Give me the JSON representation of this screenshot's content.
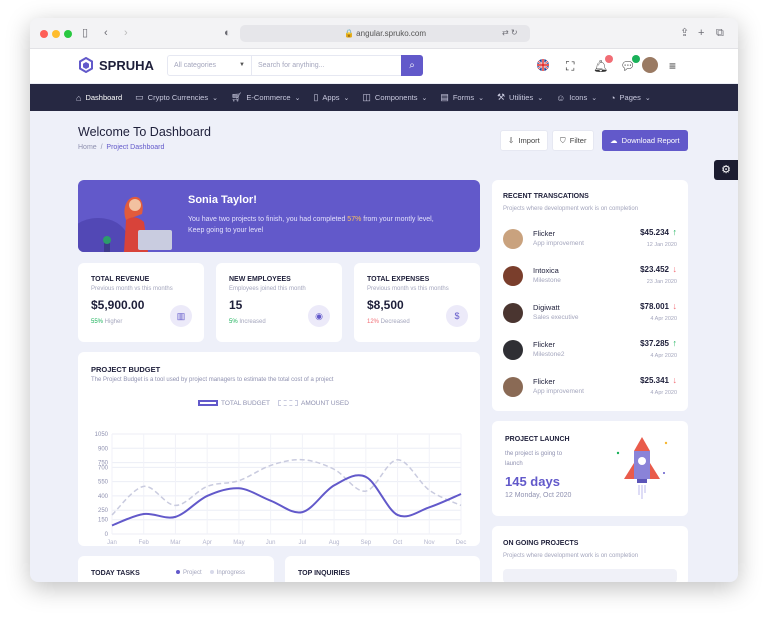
{
  "browser": {
    "url": "angular.spruko.com"
  },
  "brand": {
    "name": "SPRUHA",
    "accent": "#6259ca",
    "nav_bg": "#262842"
  },
  "header": {
    "category_select": "All categories",
    "search_placeholder": "Search for anything..."
  },
  "nav": [
    {
      "label": "Dashboard",
      "icon": "home-icon"
    },
    {
      "label": "Crypto Currencies",
      "icon": "monitor-icon"
    },
    {
      "label": "E-Commerce",
      "icon": "cart-icon"
    },
    {
      "label": "Apps",
      "icon": "apps-icon"
    },
    {
      "label": "Components",
      "icon": "box-icon"
    },
    {
      "label": "Forms",
      "icon": "form-icon"
    },
    {
      "label": "Utilities",
      "icon": "tool-icon"
    },
    {
      "label": "Icons",
      "icon": "smile-icon"
    },
    {
      "label": "Pages",
      "icon": "pages-icon"
    }
  ],
  "page": {
    "title": "Welcome To Dashboard",
    "breadcrumb_home": "Home",
    "breadcrumb_current": "Project Dashboard",
    "import_label": "Import",
    "filter_label": "Filter",
    "download_label": "Download Report"
  },
  "welcome": {
    "name": "Sonia Taylor!",
    "text_before": "You have two projects to finish, you had completed ",
    "percent": "57%",
    "text_after": " from your montly level, Keep going to your level"
  },
  "stats": [
    {
      "title": "TOTAL REVENUE",
      "sub": "Previous month vs this months",
      "value": "$5,900.00",
      "change": "55%",
      "note": " Higher",
      "change_color": "#19b159",
      "icon": "chart-icon"
    },
    {
      "title": "NEW EMPLOYEES",
      "sub": "Employees joined this month",
      "value": "15",
      "change": "5%",
      "note": " Increased",
      "change_color": "#19b159",
      "icon": "user-icon"
    },
    {
      "title": "TOTAL EXPENSES",
      "sub": "Previous month vs this months",
      "value": "$8,500",
      "change": "12%",
      "note": " Decreased",
      "change_color": "#f16d75",
      "icon": "dollar-icon"
    }
  ],
  "budget": {
    "title": "PROJECT BUDGET",
    "sub": "The Project Budget is a tool used by project managers to estimate the total cost of a project",
    "legend_total": "TOTAL BUDGET",
    "legend_amount": "AMOUNT USED"
  },
  "chart_data": {
    "type": "line",
    "categories": [
      "Jan",
      "Feb",
      "Mar",
      "Apr",
      "May",
      "Jun",
      "Jul",
      "Aug",
      "Sep",
      "Oct",
      "Nov",
      "Dec"
    ],
    "ylim": [
      0,
      1050
    ],
    "yticks": [
      0,
      150,
      250,
      400,
      550,
      700,
      750,
      900,
      1050
    ],
    "series": [
      {
        "name": "TOTAL BUDGET",
        "values": [
          90,
          210,
          180,
          400,
          480,
          350,
          230,
          510,
          600,
          200,
          280,
          420
        ]
      },
      {
        "name": "AMOUNT USED",
        "values": [
          200,
          500,
          300,
          500,
          560,
          720,
          780,
          680,
          450,
          780,
          460,
          300
        ]
      }
    ],
    "grid": true,
    "legend": "top-center"
  },
  "recent": {
    "title": "RECENT TRANSCATIONS",
    "sub": "Projects where development work is on completion",
    "items": [
      {
        "name": "Flicker",
        "desc": "App improvement",
        "amount": "$45.234",
        "dir": "up",
        "date": "12 Jan 2020",
        "avatar": "#c9a27e"
      },
      {
        "name": "Intoxica",
        "desc": "Milestone",
        "amount": "$23.452",
        "dir": "down",
        "date": "23 Jan 2020",
        "avatar": "#7a3e2c"
      },
      {
        "name": "Digiwatt",
        "desc": "Sales executive",
        "amount": "$78.001",
        "dir": "down",
        "date": "4 Apr 2020",
        "avatar": "#4a3530"
      },
      {
        "name": "Flicker",
        "desc": "Milestone2",
        "amount": "$37.285",
        "dir": "up",
        "date": "4 Apr 2020",
        "avatar": "#2f2f34"
      },
      {
        "name": "Flicker",
        "desc": "App improvement",
        "amount": "$25.341",
        "dir": "down",
        "date": "4 Apr 2020",
        "avatar": "#8a6a55"
      }
    ]
  },
  "launch": {
    "title": "PROJECT LAUNCH",
    "sub": "the project is going to launch",
    "days": "145 days",
    "date": "12 Monday, Oct 2020"
  },
  "ongoing": {
    "title": "ON GOING PROJECTS",
    "sub": "Projects where development work is on completion"
  },
  "today": {
    "title": "TODAY TASKS",
    "legend_project": "Project",
    "legend_inprogress": "Inprogress"
  },
  "top": {
    "title": "TOP INQUIRIES"
  }
}
